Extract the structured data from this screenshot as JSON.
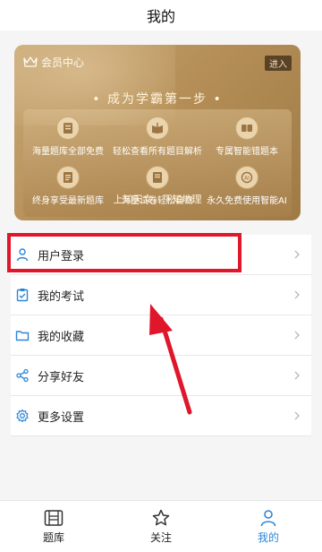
{
  "header": {
    "title": "我的"
  },
  "vip": {
    "title": "会员中心",
    "enter": "进入",
    "slogan": "• 成为学霸第一步 •",
    "features": [
      {
        "icon": "question-bank-icon",
        "label": "海量题库全部免费"
      },
      {
        "icon": "analysis-book-icon",
        "label": "轻松查看所有题目解析"
      },
      {
        "icon": "mistake-book-icon",
        "label": "专属智能错题本"
      },
      {
        "icon": "update-list-icon",
        "label": "终身享受最新题库"
      },
      {
        "icon": "exam-paper-icon",
        "label": "海量试卷轻松自测"
      },
      {
        "icon": "ai-icon",
        "label": "永久免费使用智能AI"
      }
    ],
    "footer": "上知天文，下知地理"
  },
  "menu": {
    "items": [
      {
        "label": "用户登录",
        "icon": "user-icon"
      },
      {
        "label": "我的考试",
        "icon": "clipboard-icon"
      },
      {
        "label": "我的收藏",
        "icon": "folder-icon"
      },
      {
        "label": "分享好友",
        "icon": "share-icon"
      },
      {
        "label": "更多设置",
        "icon": "gear-icon"
      }
    ]
  },
  "tabs": [
    {
      "label": "题库",
      "icon": "question-bank-tab-icon"
    },
    {
      "label": "关注",
      "icon": "star-icon"
    },
    {
      "label": "我的",
      "icon": "person-icon",
      "active": true
    }
  ],
  "colors": {
    "accent": "#2b86d9",
    "highlight": "#e0162b",
    "gold": "#b58f57"
  }
}
